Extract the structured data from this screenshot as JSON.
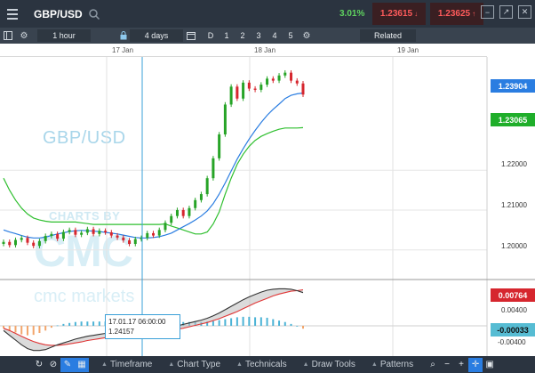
{
  "topbar": {
    "symbol": "GBP/USD",
    "change_pct": "3.01%",
    "sell_price": "1.23615",
    "buy_price": "1.23625",
    "colors": {
      "bar_bg": "#2b3440",
      "change": "#5fd35f",
      "price": "#ff5b5b"
    }
  },
  "toolbar": {
    "period": "1 hour",
    "range": "4 days",
    "timeframes": [
      "D",
      "1",
      "2",
      "3",
      "4",
      "5"
    ],
    "related": "Related"
  },
  "date_axis": [
    "17 Jan",
    "18 Jan",
    "19 Jan"
  ],
  "watermark": {
    "symbol": "GBP/USD",
    "line1": "CHARTS BY",
    "line2": "CMC",
    "line3": "cmc markets"
  },
  "price_labels": {
    "current": "1.23904",
    "ma": "1.23065"
  },
  "price_ticks": [
    "1.22000",
    "1.21000",
    "1.20000"
  ],
  "indicator_labels": {
    "top": "0.00764",
    "mid": "0.00400",
    "current": "-0.00033",
    "low": "-0.00400"
  },
  "crosshair": {
    "datetime": "17.01.17 06:00:00",
    "price": "1.24157"
  },
  "bottombar": {
    "menus": [
      "Timeframe",
      "Chart Type",
      "Technicals",
      "Draw Tools",
      "Patterns"
    ]
  },
  "chart_data": {
    "type": "candlestick",
    "title": "GBP/USD",
    "interval": "1 hour",
    "ylim": [
      1.193,
      1.248
    ],
    "yticks": [
      1.2,
      1.21,
      1.22
    ],
    "x_labels": [
      "17 Jan",
      "18 Jan",
      "19 Jan"
    ],
    "candles": [
      [
        1.2015,
        1.202
      ],
      [
        1.202,
        1.2012
      ],
      [
        1.2012,
        1.2025
      ],
      [
        1.2025,
        1.203
      ],
      [
        1.203,
        1.2018
      ],
      [
        1.2018,
        1.201
      ],
      [
        1.201,
        1.2022
      ],
      [
        1.2022,
        1.2035
      ],
      [
        1.2035,
        1.204
      ],
      [
        1.204,
        1.2028
      ],
      [
        1.2028,
        1.2045
      ],
      [
        1.2045,
        1.205
      ],
      [
        1.205,
        1.2038
      ],
      [
        1.2038,
        1.2043
      ],
      [
        1.2043,
        1.2052
      ],
      [
        1.2052,
        1.204
      ],
      [
        1.204,
        1.2048
      ],
      [
        1.2048,
        1.2044
      ],
      [
        1.2044,
        1.2036
      ],
      [
        1.2036,
        1.2031
      ],
      [
        1.2031,
        1.2024
      ],
      [
        1.2024,
        1.2015
      ],
      [
        1.2015,
        1.2027
      ],
      [
        1.2027,
        1.203
      ],
      [
        1.203,
        1.2042
      ],
      [
        1.2042,
        1.2036
      ],
      [
        1.2036,
        1.205
      ],
      [
        1.205,
        1.2068
      ],
      [
        1.2068,
        1.2085
      ],
      [
        1.2085,
        1.21
      ],
      [
        1.21,
        1.2085
      ],
      [
        1.2085,
        1.2105
      ],
      [
        1.2105,
        1.2125
      ],
      [
        1.2125,
        1.214
      ],
      [
        1.214,
        1.218
      ],
      [
        1.218,
        1.223
      ],
      [
        1.223,
        1.229
      ],
      [
        1.229,
        1.2365
      ],
      [
        1.2365,
        1.241
      ],
      [
        1.241,
        1.238
      ],
      [
        1.238,
        1.242
      ],
      [
        1.242,
        1.2405
      ],
      [
        1.2405,
        1.2402
      ],
      [
        1.2402,
        1.2415
      ],
      [
        1.2415,
        1.243
      ],
      [
        1.243,
        1.2425
      ],
      [
        1.2425,
        1.2438
      ],
      [
        1.2438,
        1.2445
      ],
      [
        1.2445,
        1.2425
      ],
      [
        1.2425,
        1.2418
      ],
      [
        1.2418,
        1.239
      ]
    ],
    "ma_fast": [
      1.205,
      1.2045,
      1.2041,
      1.2036,
      1.2032,
      1.203,
      1.203,
      1.2032,
      1.2036,
      1.204,
      1.2043,
      1.2046,
      1.2048,
      1.2049,
      1.2048,
      1.2047,
      1.2046,
      1.2044,
      1.2042,
      1.204,
      1.2037,
      1.2034,
      1.2031,
      1.203,
      1.203,
      1.2031,
      1.2033,
      1.2037,
      1.2042,
      1.205,
      1.2058,
      1.2066,
      1.2075,
      1.2085,
      1.2098,
      1.2116,
      1.214,
      1.2168,
      1.2198,
      1.2228,
      1.2254,
      1.2278,
      1.23,
      1.232,
      1.2338,
      1.2353,
      1.2366,
      1.238,
      1.2388,
      1.2392,
      1.2394
    ],
    "ma_slow": [
      1.218,
      1.215,
      1.2125,
      1.2105,
      1.209,
      1.208,
      1.2075,
      1.2072,
      1.207,
      1.207,
      1.207,
      1.207,
      1.207,
      1.2068,
      1.2066,
      1.2064,
      1.2064,
      1.2064,
      1.2064,
      1.2064,
      1.2064,
      1.2064,
      1.2064,
      1.2064,
      1.2064,
      1.2064,
      1.2064,
      1.2065,
      1.206,
      1.2055,
      1.205,
      1.2045,
      1.204,
      1.204,
      1.2045,
      1.2065,
      1.2095,
      1.214,
      1.218,
      1.2215,
      1.224,
      1.226,
      1.2275,
      1.2285,
      1.2292,
      1.2298,
      1.2303,
      1.2306,
      1.2306,
      1.2306,
      1.2307
    ],
    "indicator": {
      "ylim": [
        -0.006,
        0.009
      ],
      "macd": [
        -0.001,
        -0.002,
        -0.003,
        -0.004,
        -0.0048,
        -0.0052,
        -0.0052,
        -0.005,
        -0.0045,
        -0.004,
        -0.0036,
        -0.0032,
        -0.0028,
        -0.0025,
        -0.0022,
        -0.002,
        -0.0018,
        -0.0016,
        -0.0014,
        -0.0012,
        -0.0011,
        -0.001,
        -0.001,
        -0.0009,
        -0.0008,
        -0.0007,
        -0.0006,
        -0.0004,
        -0.0002,
        0.0,
        0.0003,
        0.0006,
        0.0009,
        0.0012,
        0.0016,
        0.0021,
        0.0027,
        0.0034,
        0.0041,
        0.0048,
        0.0055,
        0.0061,
        0.0066,
        0.0071,
        0.0075,
        0.0077,
        0.0078,
        0.0078,
        0.0077,
        0.0074,
        0.007
      ],
      "signal": [
        -0.0005,
        -0.001,
        -0.0016,
        -0.0022,
        -0.0028,
        -0.0033,
        -0.0037,
        -0.004,
        -0.0041,
        -0.0041,
        -0.004,
        -0.0038,
        -0.0036,
        -0.0034,
        -0.0031,
        -0.0029,
        -0.0027,
        -0.0025,
        -0.0023,
        -0.0021,
        -0.0019,
        -0.0017,
        -0.0016,
        -0.0015,
        -0.0014,
        -0.0013,
        -0.0012,
        -0.0011,
        -0.0009,
        -0.0007,
        -0.0005,
        -0.0002,
        0.0001,
        0.0004,
        0.0007,
        0.0011,
        0.0015,
        0.002,
        0.0025,
        0.003,
        0.0036,
        0.0042,
        0.0048,
        0.0053,
        0.0058,
        0.0063,
        0.0067,
        0.007,
        0.0073,
        0.0074,
        0.0076
      ]
    },
    "colors": {
      "up": "#27a427",
      "down": "#d6262e",
      "ma_fast": "#2a7de1",
      "ma_slow": "#2fbf2f",
      "crosshair": "#3aa0d8",
      "hist_pos": "#4bb3d6",
      "hist_neg": "#f2a56b"
    }
  }
}
